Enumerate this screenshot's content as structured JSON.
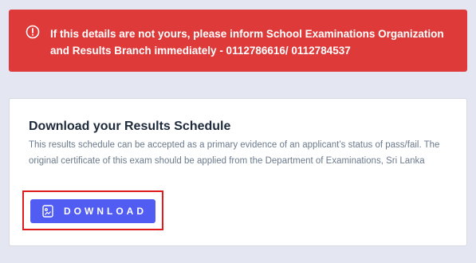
{
  "alert": {
    "icon": "exclamation-circle-icon",
    "message": "If this details are not yours, please inform School Examinations Organization and Results Branch immediately - 0112786616/ 0112784537",
    "background_color": "#de3a3a"
  },
  "card": {
    "title": "Download your Results Schedule",
    "description": "This results schedule can be accepted as a primary evidence of an applicant’s status of pass/fail. The original certificate of this exam should be applied from the Department of Examinations, Sri Lanka",
    "button": {
      "label": "DOWNLOAD",
      "icon": "document-icon",
      "color": "#515cf3",
      "highlight_color": "#e01b1b"
    }
  }
}
